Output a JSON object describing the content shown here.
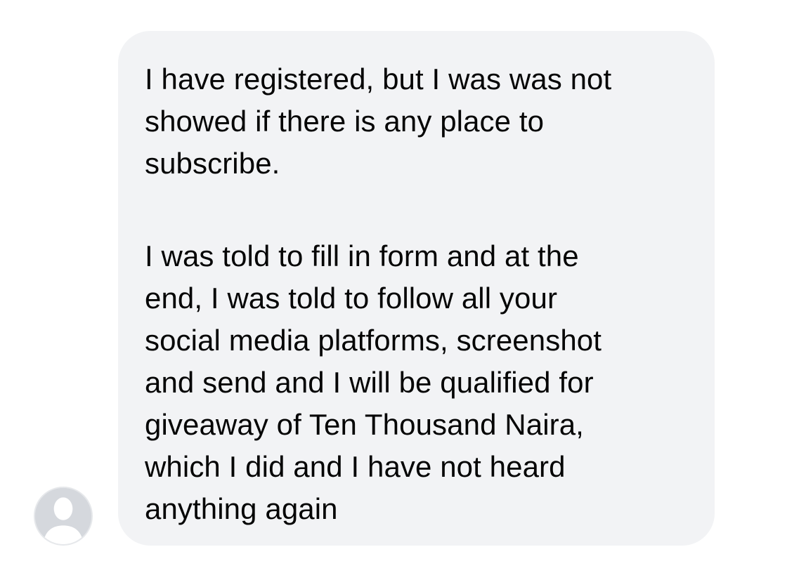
{
  "conversation": {
    "incoming_message": {
      "sender_avatar_icon": "default-user-silhouette-icon",
      "paragraphs": [
        "I have registered, but I was was not\nshowed if there is any place to\nsubscribe.",
        "I was told to fill in form and at the\nend, I was told to follow all your\nsocial media platforms, screenshot\nand send and I will be qualified for\ngiveaway of Ten Thousand Naira,\nwhich I did and I have not heard\nanything again"
      ]
    }
  },
  "colors": {
    "bubble_background": "#f2f3f5",
    "text": "#050505",
    "avatar_background": "#d5d8dd",
    "avatar_silhouette": "#ffffff"
  }
}
